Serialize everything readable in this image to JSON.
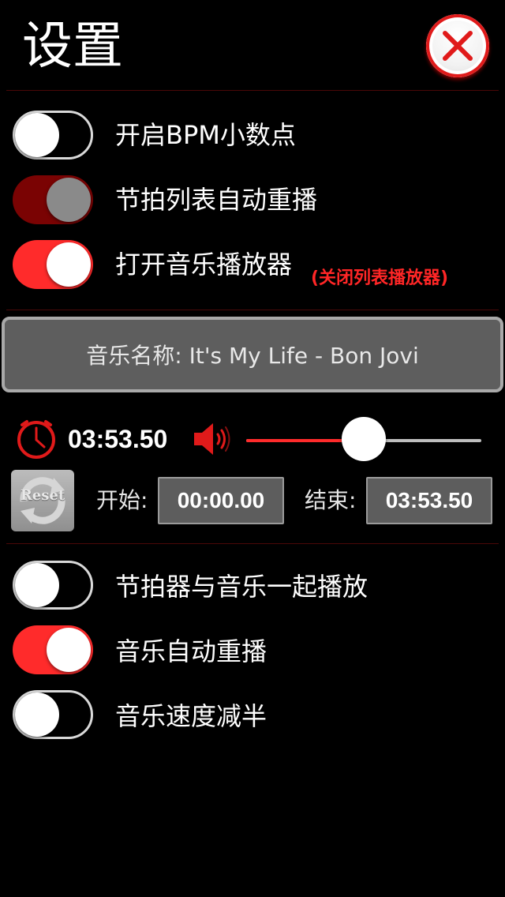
{
  "header": {
    "title": "设置",
    "close_icon": "close-icon",
    "accent": "#e01a1a"
  },
  "toggles_top": [
    {
      "label": "开启BPM小数点",
      "state": "off"
    },
    {
      "label": "节拍列表自动重播",
      "state": "on-disabled"
    },
    {
      "label": "打开音乐播放器",
      "state": "on",
      "note": "(关闭列表播放器)"
    }
  ],
  "music": {
    "name_text": "音乐名称: It's My Life - Bon Jovi"
  },
  "playback": {
    "clock_icon": "clock-icon",
    "duration": "03:53.50",
    "speaker_icon": "speaker-icon",
    "volume_level": 0.5
  },
  "range": {
    "reset_label": "Reset",
    "start_label": "开始:",
    "start_value": "00:00.00",
    "end_label": "结束:",
    "end_value": "03:53.50"
  },
  "toggles_bottom": [
    {
      "label": "节拍器与音乐一起播放",
      "state": "off"
    },
    {
      "label": "音乐自动重播",
      "state": "on"
    },
    {
      "label": "音乐速度减半",
      "state": "off"
    }
  ],
  "colors": {
    "toggle_on": "#ff2b2b",
    "toggle_disabled": "#7a0303",
    "note": "#ff2626"
  }
}
